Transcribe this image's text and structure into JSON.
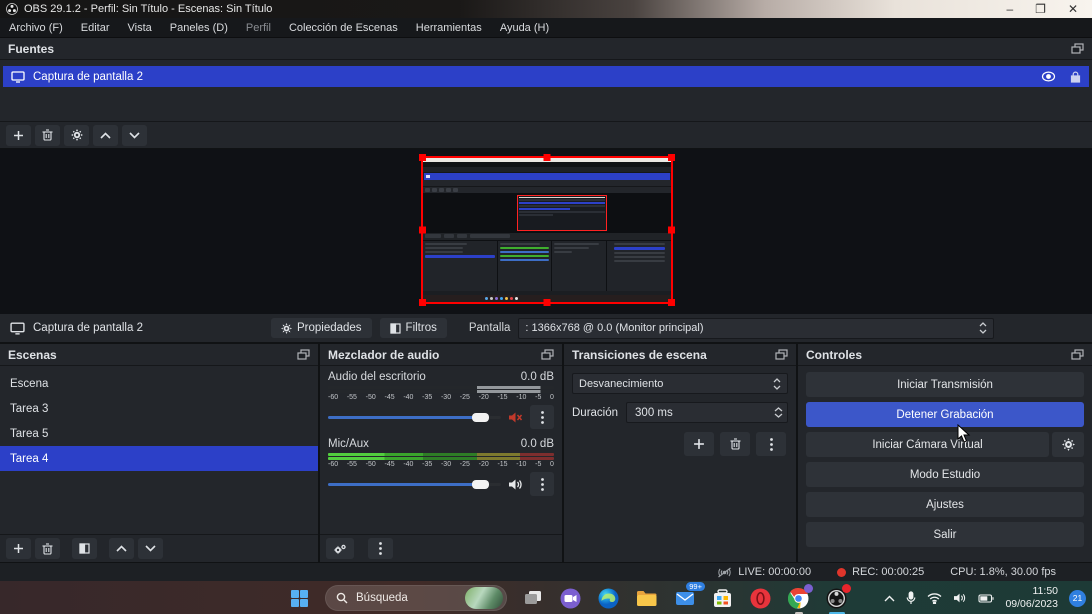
{
  "window": {
    "title": "OBS 29.1.2 - Perfil: Sin Título - Escenas: Sin Título",
    "minimize": "–",
    "maximize": "❐",
    "close": "✕"
  },
  "menubar": {
    "items": [
      "Archivo (F)",
      "Editar",
      "Vista",
      "Paneles (D)",
      "Perfil",
      "Colección de Escenas",
      "Herramientas",
      "Ayuda (H)"
    ]
  },
  "sources_panel": {
    "title": "Fuentes",
    "source_name": "Captura de pantalla 2"
  },
  "source_toolbar": {
    "source_name": "Captura de pantalla 2",
    "properties_label": "Propiedades",
    "filters_label": "Filtros",
    "screen_label": "Pantalla",
    "screen_value": ": 1366x768 @ 0.0 (Monitor principal)"
  },
  "scenes_panel": {
    "title": "Escenas",
    "items": [
      "Escena",
      "Tarea 3",
      "Tarea 5",
      "Tarea 4"
    ],
    "selected": "Tarea 4"
  },
  "mixer_panel": {
    "title": "Mezclador de audio",
    "scale_ticks": [
      "-60",
      "-55",
      "-50",
      "-45",
      "-40",
      "-35",
      "-30",
      "-25",
      "-20",
      "-15",
      "-10",
      "-5",
      "0"
    ],
    "tracks": [
      {
        "name": "Audio del escritorio",
        "level": "0.0 dB",
        "muted": true
      },
      {
        "name": "Mic/Aux",
        "level": "0.0 dB",
        "muted": false
      }
    ]
  },
  "transitions_panel": {
    "title": "Transiciones de escena",
    "transition": "Desvanecimiento",
    "duration_label": "Duración",
    "duration_value": "300 ms"
  },
  "controls_panel": {
    "title": "Controles",
    "buttons": [
      {
        "label": "Iniciar Transmisión",
        "active": false
      },
      {
        "label": "Detener Grabación",
        "active": true
      },
      {
        "label": "Iniciar Cámara Virtual",
        "active": false
      },
      {
        "label": "Modo Estudio",
        "active": false
      },
      {
        "label": "Ajustes",
        "active": false
      },
      {
        "label": "Salir",
        "active": false
      }
    ]
  },
  "statusbar": {
    "live": "LIVE: 00:00:00",
    "rec": "REC: 00:00:25",
    "cpu": "CPU: 1.8%, 30.00 fps"
  },
  "taskbar": {
    "search_placeholder": "Búsqueda",
    "mail_badge": "99+",
    "time": "11:50",
    "date": "09/06/2023",
    "notification_count": "21"
  },
  "colors": {
    "accent_blue": "#2c40c8",
    "active_button_blue": "#3c57c9",
    "record_red": "#e0352b",
    "meter_green": "#3fae2e"
  }
}
